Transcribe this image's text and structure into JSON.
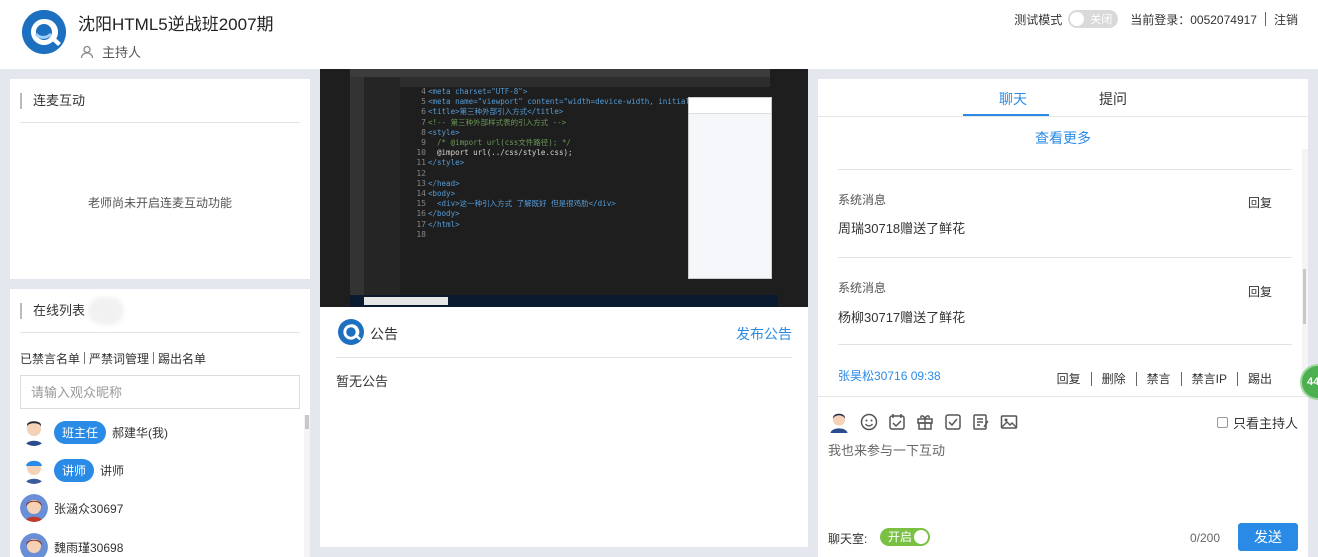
{
  "header": {
    "title": "沈阳HTML5逆战班2007期",
    "role": "主持人",
    "test_mode_label": "测试模式",
    "test_mode_toggle": "关闭",
    "login_label": "当前登录：0052074917",
    "logout": "注销"
  },
  "interact_panel": {
    "title": "连麦互动",
    "message": "老师尚未开启连麦互动功能"
  },
  "online_panel": {
    "title": "在线列表",
    "links": [
      "已禁言名单",
      "严禁词管理",
      "踢出名单"
    ],
    "search_placeholder": "请输入观众昵称",
    "users": [
      {
        "badge": "班主任",
        "name": "郝建华(我)"
      },
      {
        "badge": "讲师",
        "name": "讲师"
      },
      {
        "badge": "",
        "name": "张涵众30697"
      },
      {
        "badge": "",
        "name": "魏雨瑾30698"
      }
    ]
  },
  "video": {
    "line_numbers": [
      "4",
      "5",
      "6",
      "7",
      "8",
      "9",
      "10",
      "11",
      "12",
      "13",
      "14",
      "15",
      "16",
      "17",
      "18"
    ],
    "code_lines": [
      "<meta charset=\"UTF-8\">",
      "<meta name=\"viewport\" content=\"width=device-width, initial-",
      "<title>第三种外部引入方式</title>",
      "<!-- 第三种外部样式表的引入方式 -->",
      "<style>",
      "  /* @import url(css文件路径); */",
      "  @import url(../css/style.css);",
      "</style>",
      "",
      "</head>",
      "<body>",
      "  <div>这一种引入方式 了解既好 但是很鸡肋</div>",
      "</body>",
      "</html>",
      ""
    ]
  },
  "notice": {
    "title": "公告",
    "publish": "发布公告",
    "content": "暂无公告"
  },
  "chat": {
    "tabs": [
      "聊天",
      "提问"
    ],
    "more": "查看更多",
    "messages": [
      {
        "sender": "系统消息",
        "action": "回复",
        "text": "周瑞30718赠送了鲜花"
      },
      {
        "sender": "系统消息",
        "action": "回复",
        "text": "杨柳30717赠送了鲜花"
      }
    ],
    "last_message": {
      "sender": "张昊松30716 09:38",
      "actions": [
        "回复",
        "删除",
        "禁言",
        "禁言IP",
        "踢出"
      ]
    },
    "only_host": "只看主持人",
    "input_placeholder": "我也来参与一下互动",
    "room_label": "聊天室:",
    "room_toggle": "开启",
    "counter": "0/200",
    "send": "发送",
    "floating_badge": "44"
  },
  "colors": {
    "accent": "#2a8be7",
    "green": "#7ac143",
    "background": "#e4e8ee"
  }
}
